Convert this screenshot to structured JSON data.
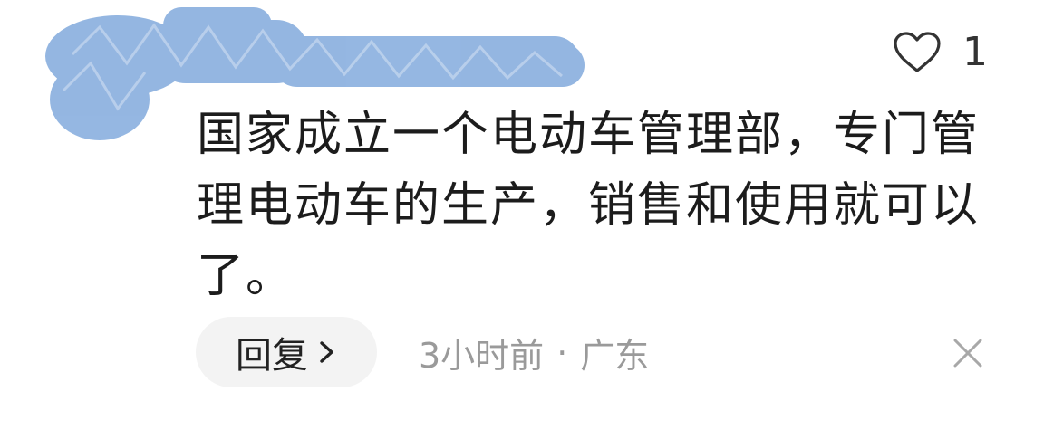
{
  "comment": {
    "text": "国家成立一个电动车管理部，专门管理电动车的生产，销售和使用就可以了。",
    "like_count": "1",
    "time": "3小时前",
    "separator": "·",
    "location": "广东"
  },
  "actions": {
    "reply_label": "回复"
  },
  "icons": {
    "like": "heart-outline-icon",
    "reply_arrow": "chevron-right-icon",
    "dismiss": "close-icon"
  },
  "colors": {
    "redaction": "#8fb3e0",
    "text": "#1c1c1c",
    "meta": "#9a9a9a",
    "reply_bg": "#f3f3f3"
  }
}
